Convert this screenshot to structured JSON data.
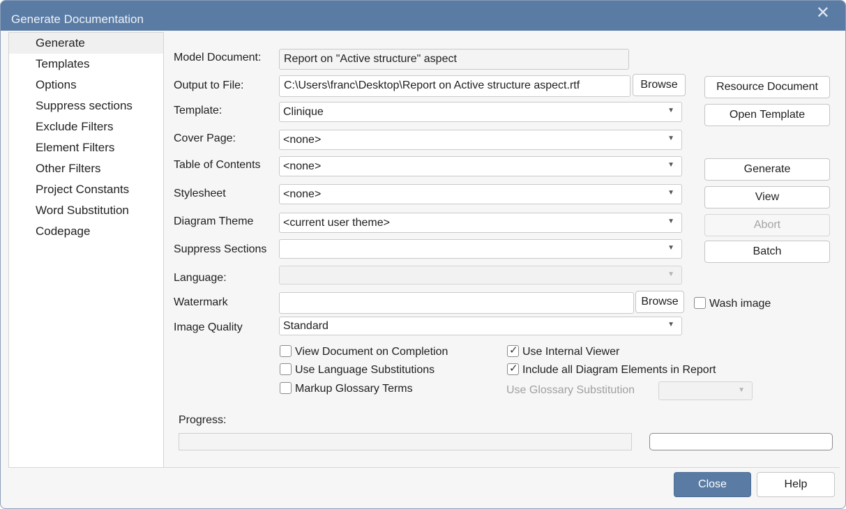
{
  "window": {
    "title": "Generate Documentation",
    "close_glyph": "✕"
  },
  "nav": {
    "items": [
      "Generate",
      "Templates",
      "Options",
      "Suppress sections",
      "Exclude Filters",
      "Element Filters",
      "Other Filters",
      "Project Constants",
      "Word Substitution",
      "Codepage"
    ],
    "selected": "Generate"
  },
  "form": {
    "model_document": {
      "label": "Model Document:",
      "value": "Report on \"Active structure\" aspect"
    },
    "output_to_file": {
      "label": "Output to File:",
      "value": "C:\\Users\\franc\\Desktop\\Report on Active structure aspect.rtf",
      "browse": "Browse"
    },
    "template": {
      "label": "Template:",
      "value": "Clinique"
    },
    "cover_page": {
      "label": "Cover Page:",
      "value": "<none>"
    },
    "table_of_contents": {
      "label": "Table of Contents",
      "value": "<none>"
    },
    "stylesheet": {
      "label": "Stylesheet",
      "value": "<none>"
    },
    "diagram_theme": {
      "label": "Diagram Theme",
      "value": "<current user theme>"
    },
    "suppress_sections": {
      "label": "Suppress Sections",
      "value": ""
    },
    "language": {
      "label": "Language:",
      "value": ""
    },
    "watermark": {
      "label": "Watermark",
      "value": "",
      "browse": "Browse"
    },
    "wash_image": {
      "label": "Wash image",
      "checked": false
    },
    "image_quality": {
      "label": "Image Quality",
      "value": "Standard"
    }
  },
  "options": {
    "view_document": {
      "label": "View Document on Completion",
      "checked": false
    },
    "use_language_substitutions": {
      "label": "Use Language Substitutions",
      "checked": false
    },
    "markup_glossary_terms": {
      "label": "Markup Glossary Terms",
      "checked": false
    },
    "use_internal_viewer": {
      "label": "Use Internal Viewer",
      "checked": true
    },
    "include_all_diagram_elements": {
      "label": "Include all Diagram Elements in Report",
      "checked": true
    },
    "use_glossary_substitution": {
      "label": "Use Glossary Substitution",
      "value": ""
    }
  },
  "side_buttons": {
    "resource_document": "Resource Document",
    "open_template": "Open Template",
    "generate": "Generate",
    "view": "View",
    "abort": "Abort",
    "batch": "Batch"
  },
  "progress": {
    "label": "Progress:",
    "value": 0
  },
  "footer": {
    "close": "Close",
    "help": "Help"
  },
  "glyphs": {
    "dropdown": "▼",
    "check": "✓"
  }
}
